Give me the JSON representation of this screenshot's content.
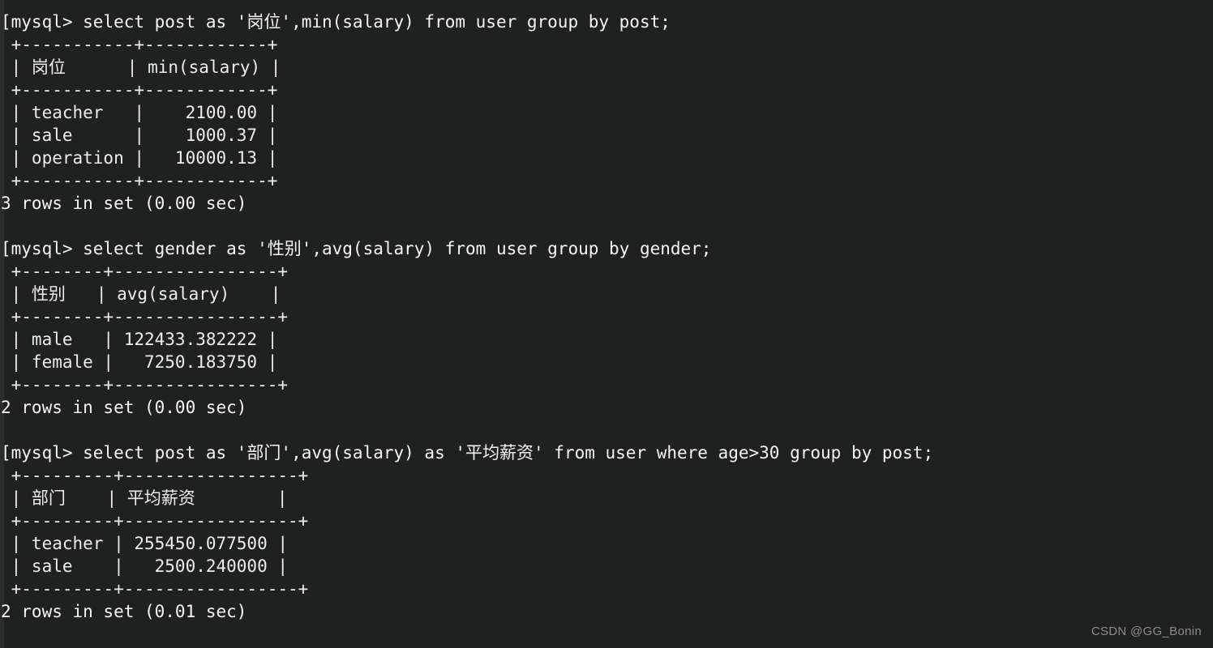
{
  "terminal": {
    "background_color": "#1f2020",
    "text_color": "#f2f2f2",
    "watermark": "CSDN @GG_Bonin",
    "prompt": "mysql>"
  },
  "blocks": [
    {
      "command": "[mysql> select post as '岗位',min(salary) from user group by post;",
      "top_rule": " +-----------+------------+",
      "header": " | 岗位      | min(salary) |",
      "mid_rule": " +-----------+------------+",
      "rows": [
        " | teacher   |    2100.00 |",
        " | sale      |    1000.37 |",
        " | operation |   10000.13 |"
      ],
      "bottom_rule": " +-----------+------------+",
      "status": "3 rows in set (0.00 sec)",
      "columns": [
        "岗位",
        "min(salary)"
      ],
      "data": [
        {
          "post": "teacher",
          "min_salary": "2100.00"
        },
        {
          "post": "sale",
          "min_salary": "1000.37"
        },
        {
          "post": "operation",
          "min_salary": "10000.13"
        }
      ],
      "row_count": 3,
      "duration": "0.00 sec"
    },
    {
      "command": "[mysql> select gender as '性别',avg(salary) from user group by gender;",
      "top_rule": " +--------+----------------+",
      "header": " | 性别   | avg(salary)    |",
      "mid_rule": " +--------+----------------+",
      "rows": [
        " | male   | 122433.382222 |",
        " | female |   7250.183750 |"
      ],
      "bottom_rule": " +--------+----------------+",
      "status": "2 rows in set (0.00 sec)",
      "columns": [
        "性别",
        "avg(salary)"
      ],
      "data": [
        {
          "gender": "male",
          "avg_salary": "122433.382222"
        },
        {
          "gender": "female",
          "avg_salary": "7250.183750"
        }
      ],
      "row_count": 2,
      "duration": "0.00 sec"
    },
    {
      "command": "[mysql> select post as '部门',avg(salary) as '平均薪资' from user where age>30 group by post;",
      "top_rule": " +---------+-----------------+",
      "header": " | 部门    | 平均薪资        |",
      "mid_rule": " +---------+-----------------+",
      "rows": [
        " | teacher | 255450.077500 |",
        " | sale    |   2500.240000 |"
      ],
      "bottom_rule": " +---------+-----------------+",
      "status": "2 rows in set (0.01 sec)",
      "columns": [
        "部门",
        "平均薪资"
      ],
      "data": [
        {
          "post": "teacher",
          "avg_salary": "255450.077500"
        },
        {
          "post": "sale",
          "avg_salary": "2500.240000"
        }
      ],
      "row_count": 2,
      "duration": "0.01 sec"
    }
  ]
}
